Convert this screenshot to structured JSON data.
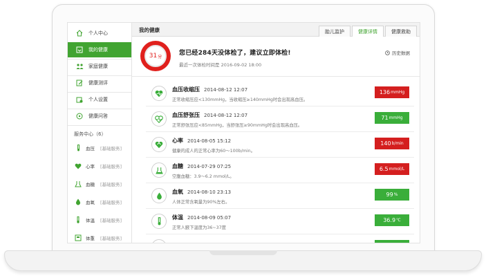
{
  "colors": {
    "accent": "#41a431",
    "alert": "#e0201d",
    "ok": "#3aae3a",
    "bad": "#d41f1f"
  },
  "sidebar": {
    "items": [
      {
        "label": "个人中心",
        "icon": "home-icon",
        "active": false
      },
      {
        "label": "我的健康",
        "icon": "heart-doc-icon",
        "active": true
      },
      {
        "label": "家庭健康",
        "icon": "family-icon",
        "active": false
      },
      {
        "label": "健康测评",
        "icon": "edit-icon",
        "active": false
      },
      {
        "label": "个人设置",
        "icon": "settings-icon",
        "active": false
      },
      {
        "label": "健康问答",
        "icon": "chat-icon",
        "active": false
      }
    ],
    "services_title": "服务中心（6）",
    "services": [
      {
        "label": "血压",
        "tag": "[基础服务]",
        "icon": "pressure-gauge-icon"
      },
      {
        "label": "心率",
        "tag": "[基础服务]",
        "icon": "heart-rate-icon"
      },
      {
        "label": "血糖",
        "tag": "[基础服务]",
        "icon": "glucose-icon"
      },
      {
        "label": "血氧",
        "tag": "[基础服务]",
        "icon": "drop-icon"
      },
      {
        "label": "体温",
        "tag": "[基础服务]",
        "icon": "thermometer-icon"
      },
      {
        "label": "体重",
        "tag": "[基础服务]",
        "icon": "scale-icon"
      }
    ]
  },
  "header": {
    "title": "我的健康",
    "tabs": [
      {
        "label": "胎儿监护",
        "active": false
      },
      {
        "label": "健康详情",
        "active": true
      },
      {
        "label": "健康救助",
        "active": false
      }
    ]
  },
  "alert": {
    "score": "31",
    "score_unit": "分",
    "message": "您已经284天没体检了，建议立即体检!",
    "last_check": "最近一次体检时间是 2016-09-02 18:00",
    "history_label": "历史数据"
  },
  "records": [
    {
      "name": "血压收缩压",
      "time": "2014-08-12 12:07",
      "desc": "正常收缩压应<130mmHg，当收缩压≥140mmHg时会出现高血压。",
      "value": "136",
      "unit": "mmHg",
      "status": "bad",
      "icon": "heart-icon"
    },
    {
      "name": "血压舒张压",
      "time": "2014-08-12 12:07",
      "desc": "正常舒张压应<85mmHg，当舒张压≥90mmHg时会出现高血压。",
      "value": "71",
      "unit": "mmHg",
      "status": "ok",
      "icon": "heart-pulse-icon"
    },
    {
      "name": "心率",
      "time": "2014-08-05 15:12",
      "desc": "健康的成人的正常心率为60～100b/min。",
      "value": "140",
      "unit": "b/min",
      "status": "bad",
      "icon": "heart-rate-icon"
    },
    {
      "name": "血糖",
      "time": "2014-07-29 07:25",
      "desc": "空腹血糖：3.9～6.2 mmol/L。",
      "value": "6.5",
      "unit": "mmol/L",
      "status": "bad",
      "icon": "glucose-icon"
    },
    {
      "name": "血氧",
      "time": "2014-08-10 23:13",
      "desc": "人体正常含氧量为90%左右。",
      "value": "99",
      "unit": "%",
      "status": "ok",
      "icon": "drop-icon"
    },
    {
      "name": "体温",
      "time": "2014-08-09 05:07",
      "desc": "正常人腋下温度为36~37度",
      "value": "36.9",
      "unit": "℃",
      "status": "ok",
      "icon": "thermometer-icon"
    }
  ]
}
